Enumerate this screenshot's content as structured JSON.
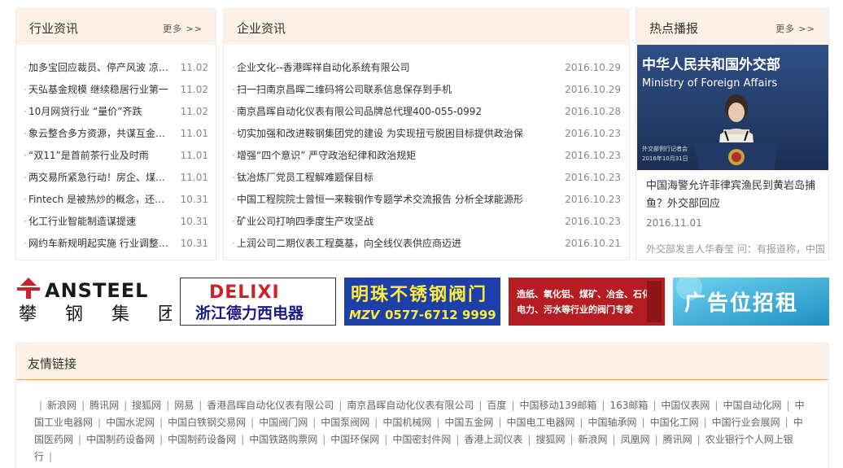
{
  "industry_news": {
    "title": "行业资讯",
    "more": "更多 >>",
    "items": [
      {
        "title": "加多宝回应裁员、停产风波 凉茶格局将生变",
        "date": "11.02"
      },
      {
        "title": "天弘基金规模 继续稳居行业第一",
        "date": "11.02"
      },
      {
        "title": "10月网贷行业 “量价”齐跌",
        "date": "11.02"
      },
      {
        "title": "象云整合多方资源，共谋互金新发展",
        "date": "11.01"
      },
      {
        "title": "“双11”是首前茶行业及时雨",
        "date": "11.01"
      },
      {
        "title": "两交易所紧急行动！房企、煤炭企业发债受限",
        "date": "11.01"
      },
      {
        "title": "Fintech 是被热炒的概念，还是真正的趋势",
        "date": "10.31"
      },
      {
        "title": "化工行业智能制造谋提速",
        "date": "10.31"
      },
      {
        "title": "网约车新规明起实施 行业调整期来临",
        "date": "10.31"
      }
    ]
  },
  "company_news": {
    "title": "企业资讯",
    "items": [
      {
        "title": "企业文化--香港晖祥自动化系统有限公司",
        "date": "2016.10.29"
      },
      {
        "title": "扫一扫南京昌晖二维码将公司联系信息保存到手机",
        "date": "2016.10.29"
      },
      {
        "title": "南京昌晖自动化仪表有限公司品牌总代理400-055-0992",
        "date": "2016.10.28"
      },
      {
        "title": "切实加强和改进鞍钢集团党的建设 为实现扭亏脱困目标提供政治保",
        "date": "2016.10.23"
      },
      {
        "title": "增强“四个意识” 严守政治纪律和政治规矩",
        "date": "2016.10.23"
      },
      {
        "title": "钛冶炼厂党员工程解难题保目标",
        "date": "2016.10.23"
      },
      {
        "title": "中国工程院院士曾恒一来鞍钢作专题学术交流报告 分析全球能源形",
        "date": "2016.10.23"
      },
      {
        "title": "矿业公司打响四季度生产攻坚战",
        "date": "2016.10.23"
      },
      {
        "title": "上润公司二期仪表工程奠基，向全线仪表供应商迈进",
        "date": "2016.10.21"
      }
    ]
  },
  "hot_news": {
    "title": "热点播报",
    "more": "更多 >>",
    "photo_sign_cn": "中华人民共和国外交部",
    "photo_sign_en": "Ministry of Foreign Affairs",
    "photo_caption": "外交部例行记者会",
    "photo_date": "2016年10月31日",
    "headline": "中国海警允许菲律宾渔民到黄岩岛捕鱼？外交部回应",
    "date": "2016.11.01",
    "summary": "外交部发言人华春莹 问：有报道称，中国海警允许菲律宾渔民到黄岩岛附近捕鱼"
  },
  "ads": [
    {
      "name": "ANSTEEL",
      "sub": "攀 钢 集 团"
    },
    {
      "name": "DELIXI",
      "sub": "浙江德力西电器"
    },
    {
      "name": "明珠不锈钢阀门",
      "sub": "0577-6712 9999",
      "brand": "MZV"
    },
    {
      "line1": "造纸、氧化铝、煤矿、冶金、石化、",
      "line2": "电力、污水等行业的阀门专家"
    },
    {
      "name": "广告位招租"
    }
  ],
  "friend_links": {
    "title": "友情链接",
    "items": [
      "新浪网",
      "腾讯网",
      "搜狐网",
      "网易",
      "香港昌晖自动化仪表有限公司",
      "南京昌晖自动化仪表有限公司",
      "百度",
      "中国移动139邮箱",
      "163邮箱",
      "中国仪表网",
      "中国自动化网",
      "中国工业电器网",
      "中国水泥网",
      "中国白铁钢交易网",
      "中国阀门网",
      "中国泵阀网",
      "中国机械网",
      "中国五金网",
      "中国电工电器网",
      "中国轴承网",
      "中国化工网",
      "中国行业会展网",
      "中国医药网",
      "中国制药设备网",
      "中国制药设备网",
      "中国铁路购票网",
      "中国环保网",
      "中国密封件网",
      "香港上润仪表",
      "搜狐网",
      "新浪网",
      "凤凰网",
      "腾讯网",
      "农业银行个人网上银行"
    ]
  },
  "colors": {
    "header_bg": "#fdf0e6",
    "accent_line": "#f0a35c"
  }
}
